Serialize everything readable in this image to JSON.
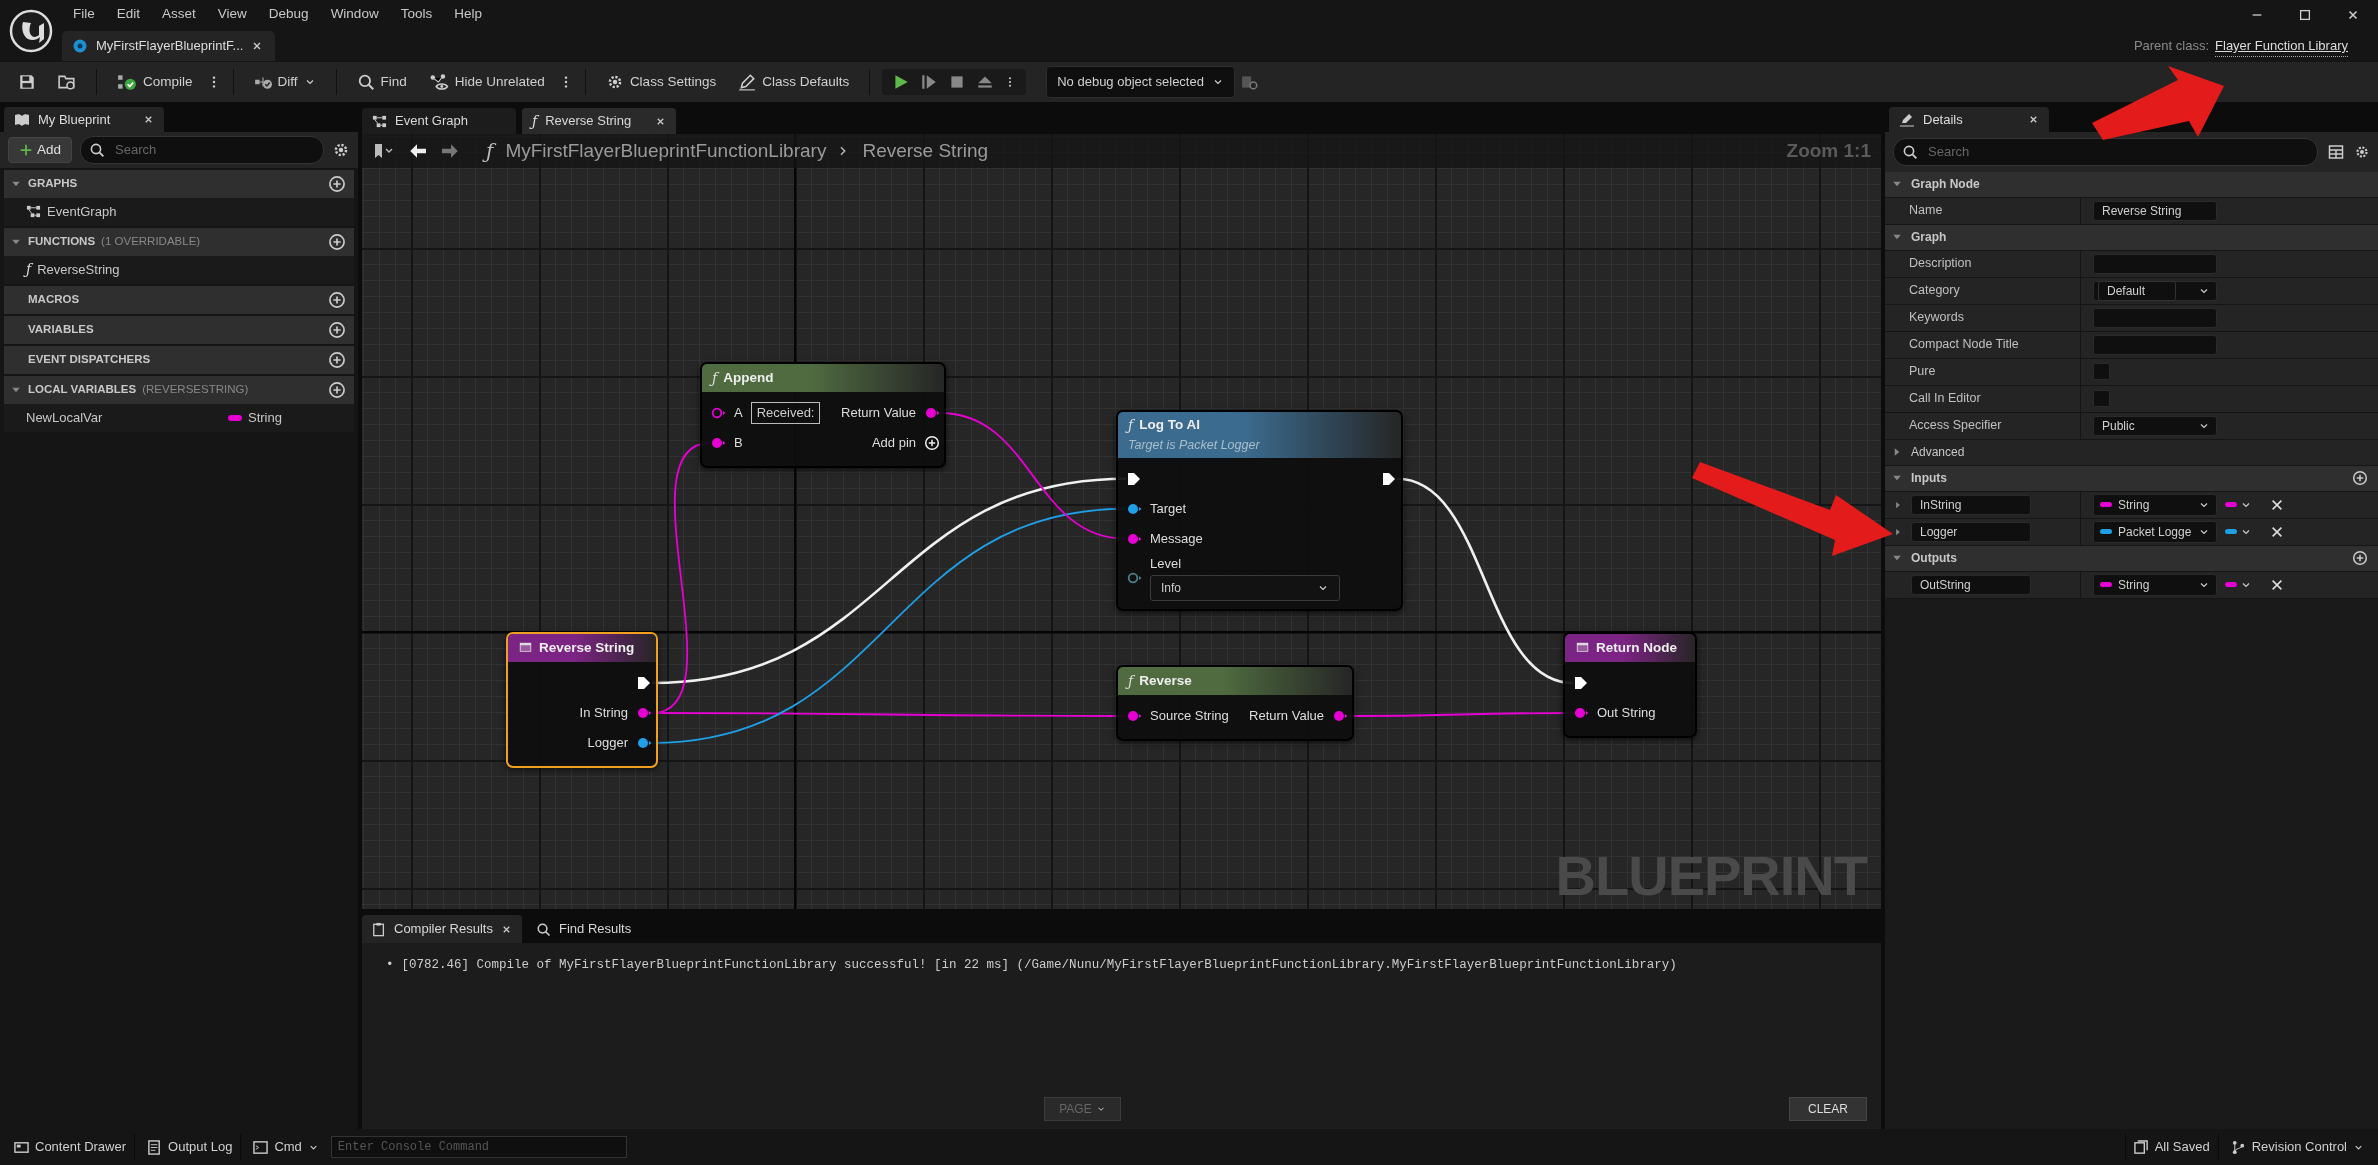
{
  "menu": [
    "File",
    "Edit",
    "Asset",
    "View",
    "Debug",
    "Window",
    "Tools",
    "Help"
  ],
  "document_tab": {
    "title": "MyFirstFlayerBlueprintF..."
  },
  "parent_class": {
    "label": "Parent class:",
    "value": "Flayer Function Library"
  },
  "toolbar": {
    "compile": "Compile",
    "diff": "Diff",
    "find": "Find",
    "hide_unrelated": "Hide Unrelated",
    "class_settings": "Class Settings",
    "class_defaults": "Class Defaults",
    "debug_object": "No debug object selected"
  },
  "my_blueprint": {
    "title": "My Blueprint",
    "add": "Add",
    "search_placeholder": "Search",
    "sections": [
      {
        "title": "GRAPHS",
        "expanded": true,
        "items": [
          {
            "kind": "graph",
            "label": "EventGraph"
          }
        ]
      },
      {
        "title": "FUNCTIONS",
        "note": "(1 OVERRIDABLE)",
        "expanded": true,
        "items": [
          {
            "kind": "function",
            "glyph": "ƒ",
            "label": "ReverseString"
          }
        ]
      },
      {
        "title": "MACROS"
      },
      {
        "title": "VARIABLES"
      },
      {
        "title": "EVENT DISPATCHERS"
      },
      {
        "title": "LOCAL VARIABLES",
        "note": "(REVERSESTRING)",
        "expanded": true,
        "items": [
          {
            "kind": "variable",
            "label": "NewLocalVar",
            "type": "String",
            "color": "#e600d4"
          }
        ]
      }
    ]
  },
  "graph_tabs": [
    {
      "kind": "graph",
      "label": "Event Graph",
      "selected": false
    },
    {
      "kind": "function",
      "glyph": "ƒ",
      "label": "Reverse String",
      "selected": true
    }
  ],
  "breadcrumb": {
    "glyph": "ƒ",
    "path": [
      "MyFirstFlayerBlueprintFunctionLibrary",
      "Reverse String"
    ]
  },
  "zoom": "Zoom 1:1",
  "watermark": "BLUEPRINT",
  "nodes": [
    {
      "kind": "function",
      "color": "#4f6b3f",
      "glyph": "ƒ",
      "title": "Append",
      "selected": false,
      "inputs": [
        {
          "kind": "data",
          "label": "A",
          "color": "#e600d4",
          "connected": false,
          "value": "Received:"
        },
        {
          "kind": "data",
          "label": "B",
          "color": "#e600d4",
          "connected": true
        }
      ],
      "outputs": [
        {
          "kind": "data",
          "label": "Return Value",
          "color": "#e600d4",
          "connected": true
        },
        {
          "kind": "add",
          "label": "Add pin"
        }
      ]
    },
    {
      "kind": "function",
      "color": "#3b6b8e",
      "glyph": "ƒ",
      "title": "Log To AI",
      "subtitle": "Target is Packet Logger",
      "selected": false,
      "inputs": [
        {
          "kind": "exec",
          "connected": true
        },
        {
          "kind": "data",
          "label": "Target",
          "color": "#1e9fe6",
          "connected": true
        },
        {
          "kind": "data",
          "label": "Message",
          "color": "#e600d4",
          "connected": true
        },
        {
          "kind": "enum",
          "label": "Level",
          "color": "#4d7d8a",
          "connected": false,
          "value": "Info"
        }
      ],
      "outputs": [
        {
          "kind": "exec",
          "connected": true
        }
      ]
    },
    {
      "kind": "entry",
      "color": "#7c2483",
      "title": "Reverse String",
      "selected": true,
      "outputs": [
        {
          "kind": "exec",
          "connected": true
        },
        {
          "kind": "data",
          "label": "In String",
          "color": "#e600d4",
          "connected": true
        },
        {
          "kind": "data",
          "label": "Logger",
          "color": "#1e9fe6",
          "connected": true
        }
      ]
    },
    {
      "kind": "function",
      "color": "#4f6b3f",
      "glyph": "ƒ",
      "title": "Reverse",
      "selected": false,
      "inputs": [
        {
          "kind": "data",
          "label": "Source String",
          "color": "#e600d4",
          "connected": true
        }
      ],
      "outputs": [
        {
          "kind": "data",
          "label": "Return Value",
          "color": "#e600d4",
          "connected": true
        }
      ]
    },
    {
      "kind": "return",
      "color": "#7c2483",
      "title": "Return Node",
      "selected": false,
      "inputs": [
        {
          "kind": "exec",
          "connected": true
        },
        {
          "kind": "data",
          "label": "Out String",
          "color": "#e600d4",
          "connected": true
        }
      ]
    }
  ],
  "compiler": {
    "tabs": [
      {
        "label": "Compiler Results",
        "selected": true
      },
      {
        "label": "Find Results",
        "selected": false
      }
    ],
    "bullet": "•",
    "lines": [
      "[0782.46] Compile of MyFirstFlayerBlueprintFunctionLibrary successful! [in 22 ms] (/Game/Nunu/MyFirstFlayerBlueprintFunctionLibrary.MyFirstFlayerBlueprintFunctionLibrary)"
    ],
    "page": {
      "label": "PAGE",
      "disabled": true
    },
    "clear": "CLEAR"
  },
  "details": {
    "title": "Details",
    "search_placeholder": "Search",
    "sections": [
      {
        "title": "Graph Node",
        "kind": "category",
        "expanded": true,
        "addable": false,
        "rows": [
          {
            "kind": "text",
            "label": "Name",
            "value": "Reverse String"
          }
        ]
      },
      {
        "title": "Graph",
        "kind": "category",
        "expanded": true,
        "addable": false,
        "rows": [
          {
            "kind": "text",
            "label": "Description"
          },
          {
            "kind": "combo",
            "label": "Category",
            "value": "Default"
          },
          {
            "kind": "text",
            "label": "Keywords"
          },
          {
            "kind": "text",
            "label": "Compact Node Title"
          },
          {
            "kind": "checkbox",
            "label": "Pure",
            "checked": false
          },
          {
            "kind": "checkbox",
            "label": "Call In Editor",
            "checked": false
          },
          {
            "kind": "select",
            "label": "Access Specifier",
            "value": "Public"
          }
        ]
      },
      {
        "title": "Advanced",
        "kind": "group",
        "expanded": false,
        "addable": false
      },
      {
        "title": "Inputs",
        "kind": "category",
        "expanded": true,
        "addable": true,
        "rows": [
          {
            "kind": "param",
            "name": "InString",
            "type": "String",
            "color": "#e600d4",
            "expanded": false
          },
          {
            "kind": "param",
            "name": "Logger",
            "type": "Packet Logge",
            "color": "#1e9fe6",
            "expanded": false
          }
        ]
      },
      {
        "title": "Outputs",
        "kind": "category",
        "expanded": true,
        "addable": true,
        "rows": [
          {
            "kind": "param",
            "name": "OutString",
            "type": "String",
            "color": "#e600d4"
          }
        ]
      }
    ]
  },
  "status_bar": {
    "content_drawer": "Content Drawer",
    "output_log": "Output Log",
    "cmd": "Cmd",
    "console_placeholder": "Enter Console Command",
    "saved": "All Saved",
    "revision": "Revision Control"
  }
}
